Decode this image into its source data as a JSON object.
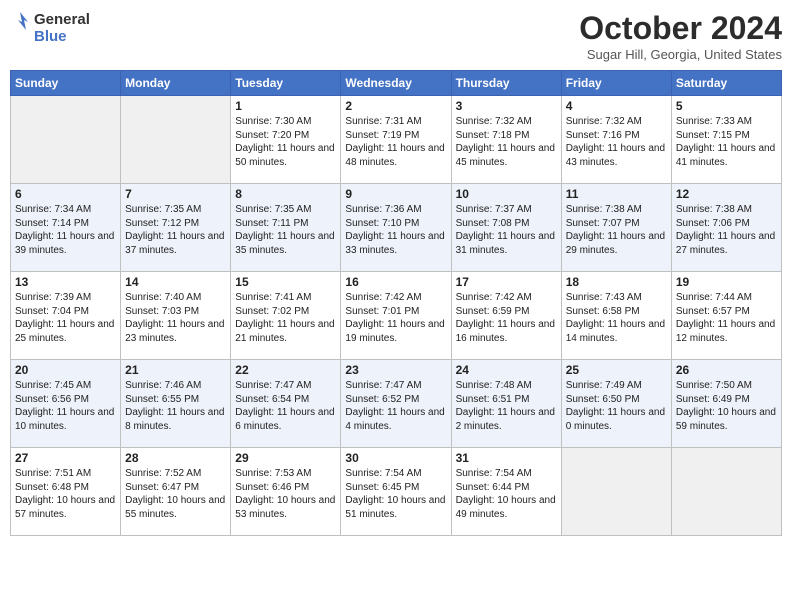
{
  "header": {
    "logo_line1": "General",
    "logo_line2": "Blue",
    "month_title": "October 2024",
    "location": "Sugar Hill, Georgia, United States"
  },
  "days_of_week": [
    "Sunday",
    "Monday",
    "Tuesday",
    "Wednesday",
    "Thursday",
    "Friday",
    "Saturday"
  ],
  "weeks": [
    [
      {
        "day": "",
        "empty": true
      },
      {
        "day": "",
        "empty": true
      },
      {
        "day": "1",
        "sunrise": "Sunrise: 7:30 AM",
        "sunset": "Sunset: 7:20 PM",
        "daylight": "Daylight: 11 hours and 50 minutes."
      },
      {
        "day": "2",
        "sunrise": "Sunrise: 7:31 AM",
        "sunset": "Sunset: 7:19 PM",
        "daylight": "Daylight: 11 hours and 48 minutes."
      },
      {
        "day": "3",
        "sunrise": "Sunrise: 7:32 AM",
        "sunset": "Sunset: 7:18 PM",
        "daylight": "Daylight: 11 hours and 45 minutes."
      },
      {
        "day": "4",
        "sunrise": "Sunrise: 7:32 AM",
        "sunset": "Sunset: 7:16 PM",
        "daylight": "Daylight: 11 hours and 43 minutes."
      },
      {
        "day": "5",
        "sunrise": "Sunrise: 7:33 AM",
        "sunset": "Sunset: 7:15 PM",
        "daylight": "Daylight: 11 hours and 41 minutes."
      }
    ],
    [
      {
        "day": "6",
        "sunrise": "Sunrise: 7:34 AM",
        "sunset": "Sunset: 7:14 PM",
        "daylight": "Daylight: 11 hours and 39 minutes."
      },
      {
        "day": "7",
        "sunrise": "Sunrise: 7:35 AM",
        "sunset": "Sunset: 7:12 PM",
        "daylight": "Daylight: 11 hours and 37 minutes."
      },
      {
        "day": "8",
        "sunrise": "Sunrise: 7:35 AM",
        "sunset": "Sunset: 7:11 PM",
        "daylight": "Daylight: 11 hours and 35 minutes."
      },
      {
        "day": "9",
        "sunrise": "Sunrise: 7:36 AM",
        "sunset": "Sunset: 7:10 PM",
        "daylight": "Daylight: 11 hours and 33 minutes."
      },
      {
        "day": "10",
        "sunrise": "Sunrise: 7:37 AM",
        "sunset": "Sunset: 7:08 PM",
        "daylight": "Daylight: 11 hours and 31 minutes."
      },
      {
        "day": "11",
        "sunrise": "Sunrise: 7:38 AM",
        "sunset": "Sunset: 7:07 PM",
        "daylight": "Daylight: 11 hours and 29 minutes."
      },
      {
        "day": "12",
        "sunrise": "Sunrise: 7:38 AM",
        "sunset": "Sunset: 7:06 PM",
        "daylight": "Daylight: 11 hours and 27 minutes."
      }
    ],
    [
      {
        "day": "13",
        "sunrise": "Sunrise: 7:39 AM",
        "sunset": "Sunset: 7:04 PM",
        "daylight": "Daylight: 11 hours and 25 minutes."
      },
      {
        "day": "14",
        "sunrise": "Sunrise: 7:40 AM",
        "sunset": "Sunset: 7:03 PM",
        "daylight": "Daylight: 11 hours and 23 minutes."
      },
      {
        "day": "15",
        "sunrise": "Sunrise: 7:41 AM",
        "sunset": "Sunset: 7:02 PM",
        "daylight": "Daylight: 11 hours and 21 minutes."
      },
      {
        "day": "16",
        "sunrise": "Sunrise: 7:42 AM",
        "sunset": "Sunset: 7:01 PM",
        "daylight": "Daylight: 11 hours and 19 minutes."
      },
      {
        "day": "17",
        "sunrise": "Sunrise: 7:42 AM",
        "sunset": "Sunset: 6:59 PM",
        "daylight": "Daylight: 11 hours and 16 minutes."
      },
      {
        "day": "18",
        "sunrise": "Sunrise: 7:43 AM",
        "sunset": "Sunset: 6:58 PM",
        "daylight": "Daylight: 11 hours and 14 minutes."
      },
      {
        "day": "19",
        "sunrise": "Sunrise: 7:44 AM",
        "sunset": "Sunset: 6:57 PM",
        "daylight": "Daylight: 11 hours and 12 minutes."
      }
    ],
    [
      {
        "day": "20",
        "sunrise": "Sunrise: 7:45 AM",
        "sunset": "Sunset: 6:56 PM",
        "daylight": "Daylight: 11 hours and 10 minutes."
      },
      {
        "day": "21",
        "sunrise": "Sunrise: 7:46 AM",
        "sunset": "Sunset: 6:55 PM",
        "daylight": "Daylight: 11 hours and 8 minutes."
      },
      {
        "day": "22",
        "sunrise": "Sunrise: 7:47 AM",
        "sunset": "Sunset: 6:54 PM",
        "daylight": "Daylight: 11 hours and 6 minutes."
      },
      {
        "day": "23",
        "sunrise": "Sunrise: 7:47 AM",
        "sunset": "Sunset: 6:52 PM",
        "daylight": "Daylight: 11 hours and 4 minutes."
      },
      {
        "day": "24",
        "sunrise": "Sunrise: 7:48 AM",
        "sunset": "Sunset: 6:51 PM",
        "daylight": "Daylight: 11 hours and 2 minutes."
      },
      {
        "day": "25",
        "sunrise": "Sunrise: 7:49 AM",
        "sunset": "Sunset: 6:50 PM",
        "daylight": "Daylight: 11 hours and 0 minutes."
      },
      {
        "day": "26",
        "sunrise": "Sunrise: 7:50 AM",
        "sunset": "Sunset: 6:49 PM",
        "daylight": "Daylight: 10 hours and 59 minutes."
      }
    ],
    [
      {
        "day": "27",
        "sunrise": "Sunrise: 7:51 AM",
        "sunset": "Sunset: 6:48 PM",
        "daylight": "Daylight: 10 hours and 57 minutes."
      },
      {
        "day": "28",
        "sunrise": "Sunrise: 7:52 AM",
        "sunset": "Sunset: 6:47 PM",
        "daylight": "Daylight: 10 hours and 55 minutes."
      },
      {
        "day": "29",
        "sunrise": "Sunrise: 7:53 AM",
        "sunset": "Sunset: 6:46 PM",
        "daylight": "Daylight: 10 hours and 53 minutes."
      },
      {
        "day": "30",
        "sunrise": "Sunrise: 7:54 AM",
        "sunset": "Sunset: 6:45 PM",
        "daylight": "Daylight: 10 hours and 51 minutes."
      },
      {
        "day": "31",
        "sunrise": "Sunrise: 7:54 AM",
        "sunset": "Sunset: 6:44 PM",
        "daylight": "Daylight: 10 hours and 49 minutes."
      },
      {
        "day": "",
        "empty": true
      },
      {
        "day": "",
        "empty": true
      }
    ]
  ]
}
